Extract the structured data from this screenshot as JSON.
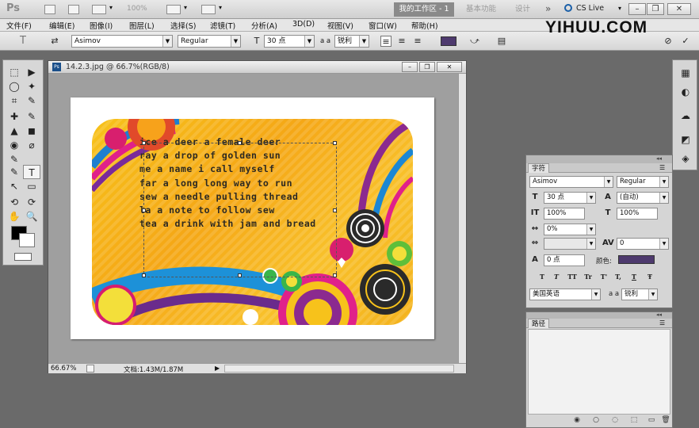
{
  "appbar": {
    "logo": "Ps",
    "zoom_value": "100%",
    "workspace_active": "我的工作区 - 1",
    "workspace_basic": "基本功能",
    "workspace_design": "设计",
    "overflow": "»",
    "cs_live": "CS Live",
    "cs_live_arrow": "▾",
    "btn_minimize": "–",
    "btn_restore": "❐",
    "btn_close": "✕"
  },
  "brand": "YIHUU.COM",
  "menu": [
    "文件(F)",
    "编辑(E)",
    "图像(I)",
    "图层(L)",
    "选择(S)",
    "滤镜(T)",
    "分析(A)",
    "3D(D)",
    "视图(V)",
    "窗口(W)",
    "帮助(H)"
  ],
  "options": {
    "tool_icon": "T",
    "font_family": "Asimov",
    "font_style": "Regular",
    "size_icon": "T",
    "font_size": "30 点",
    "aa_label": "a a",
    "aa_value": "锐利",
    "swatch_color": "#4e3a6e"
  },
  "toolbar": {
    "tools": [
      "⬚",
      "▶",
      "◯",
      "✦",
      "⌗",
      "✎",
      "✚",
      "✎",
      "▲",
      "◼",
      "◉",
      "⌀",
      "✎",
      "T",
      "↖",
      "▭",
      "✋",
      "🔍"
    ]
  },
  "document": {
    "title": "14.2.3.jpg @ 66.7%(RGB/8)",
    "ps_badge": "Ps",
    "zoom": "66.67%",
    "doc_info": "文档:1.43M/1.87M",
    "text_lines": [
      "ice a deer a female deer",
      "ray a drop of golden sun",
      "me a name i call myself",
      "far a long long way to run",
      "sew a needle pulling thread",
      "la a note to follow sew",
      "tea a drink with jam and bread"
    ]
  },
  "right_strip": {
    "icons": [
      "▦",
      "◐",
      "☁",
      "◩",
      "◈"
    ]
  },
  "character_panel": {
    "tab": "字符",
    "font_family": "Asimov",
    "font_style": "Regular",
    "size": "30 点",
    "leading": "(自动)",
    "vscale": "100%",
    "hscale": "100%",
    "kerning": "0%",
    "tracking": "0",
    "baseline": "0 点",
    "color_label": "颜色:",
    "color": "#4e3a6e",
    "style_buttons": [
      "T",
      "T",
      "TT",
      "Tr",
      "T'",
      "T,",
      "T",
      "Ŧ"
    ],
    "language": "美国英语",
    "aa_label": "a a",
    "aa_value": "锐利"
  },
  "paths_panel": {
    "tab": "路径",
    "footer_icons": [
      "◉",
      "○",
      "◌",
      "⬚",
      "▭",
      "🗑"
    ]
  }
}
